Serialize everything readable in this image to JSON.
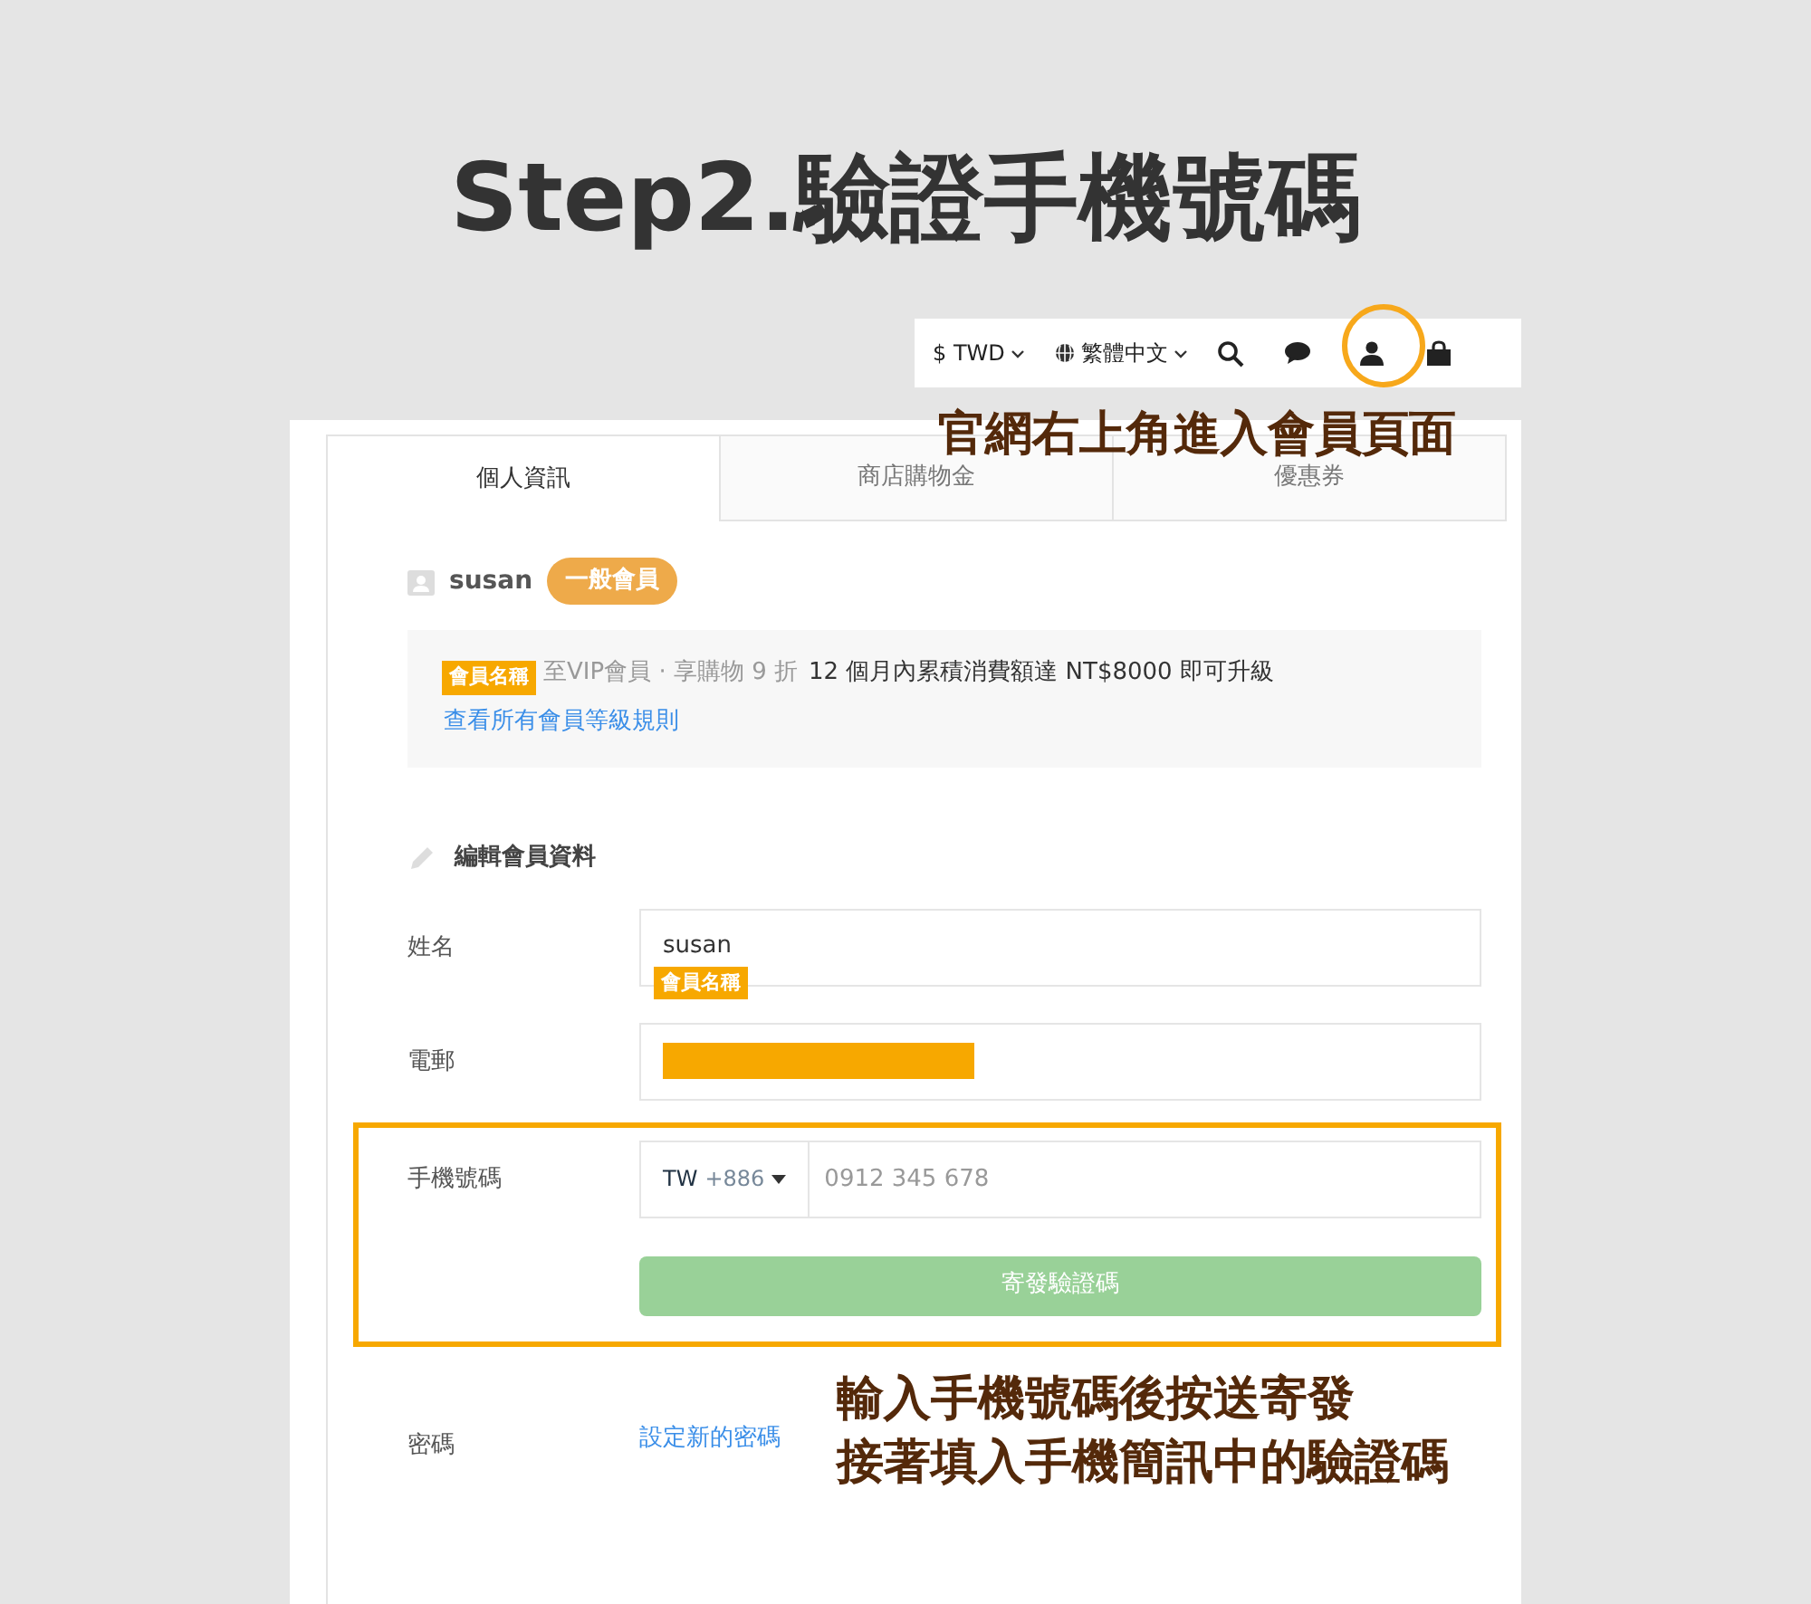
{
  "title": "Step2.驗證手機號碼",
  "topbar": {
    "currency": "$ TWD",
    "language": "繁體中文",
    "account_highlighted": true
  },
  "annotations": [
    {
      "lines": [
        "官網右上角進入會員頁面"
      ]
    },
    {
      "lines": [
        "輸入手機號碼後按送寄發",
        "接著填入手機簡訊中的驗證碼"
      ]
    }
  ],
  "tabs": [
    {
      "label": "個人資訊",
      "selected": true
    },
    {
      "label": "商店購物金",
      "selected": false
    },
    {
      "label": "優惠券",
      "selected": false
    }
  ],
  "member": {
    "name": "susan",
    "level_badge": "一般會員",
    "tag": "會員名稱",
    "upgrade_info": "至VIP會員 · 享購物 9 折",
    "upgrade_condition": "12 個月內累積消費額達 NT$8000 即可升級",
    "rules_link": "查看所有會員等級規則"
  },
  "edit_section": {
    "heading": "編輯會員資料",
    "fields": [
      {
        "kind": "text",
        "label": "姓名",
        "value": "susan",
        "tag": "會員名稱"
      },
      {
        "kind": "redacted",
        "label": "電郵"
      },
      {
        "kind": "phone",
        "label": "手機號碼",
        "country": "TW",
        "dial_code": "+886",
        "placeholder": "0912 345 678",
        "button": "寄發驗證碼",
        "highlighted": true
      },
      {
        "kind": "link",
        "label": "密碼",
        "link": "設定新的密碼"
      }
    ]
  }
}
